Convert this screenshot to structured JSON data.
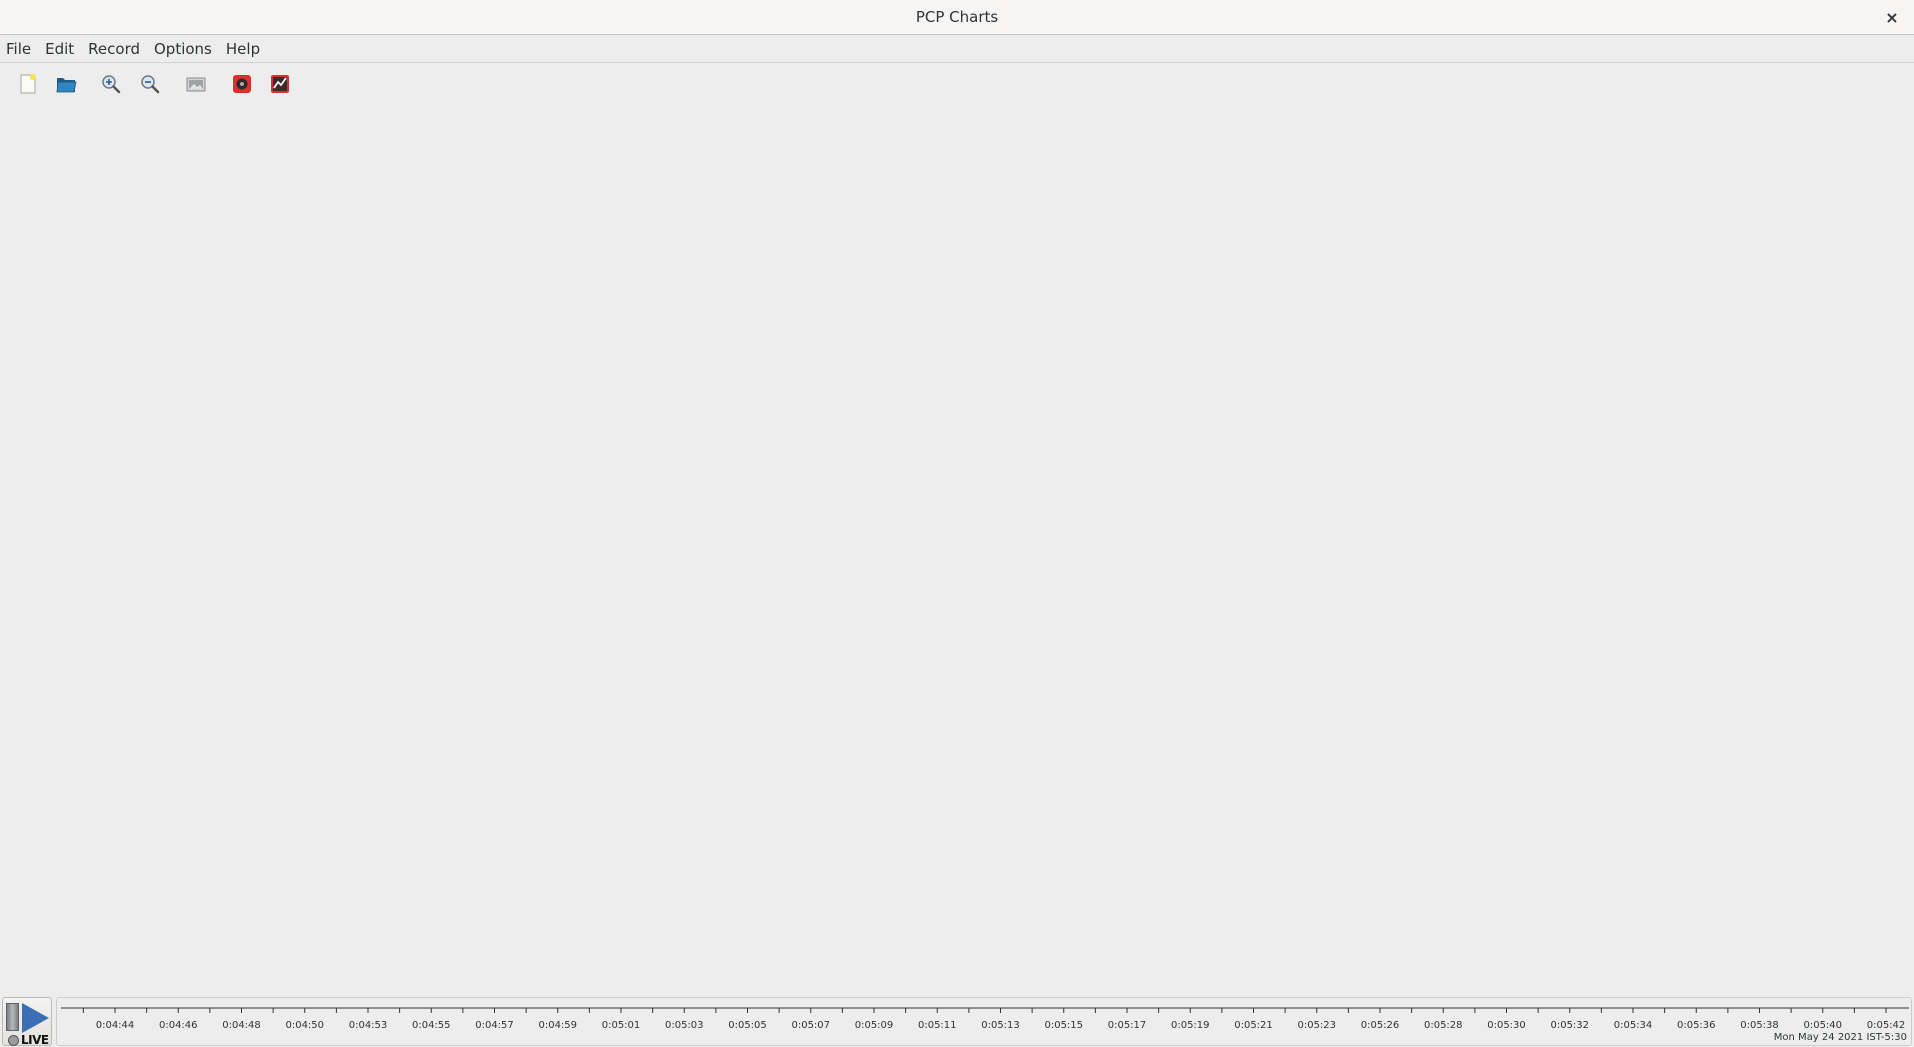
{
  "window": {
    "title": "PCP Charts",
    "close_glyph": "×"
  },
  "menu": [
    "File",
    "Edit",
    "Record",
    "Options",
    "Help"
  ],
  "toolbar": [
    {
      "name": "new-chart-button",
      "icon": "new-document-icon"
    },
    {
      "name": "open-view-button",
      "icon": "open-folder-icon"
    },
    {
      "name": "zoom-in-button",
      "icon": "zoom-in-icon"
    },
    {
      "name": "zoom-out-button",
      "icon": "zoom-out-icon"
    },
    {
      "name": "export-image-button",
      "icon": "image-icon"
    },
    {
      "name": "record-button",
      "icon": "record-icon"
    },
    {
      "name": "new-chart-button-2",
      "icon": "chart-icon"
    }
  ],
  "timecontrol": {
    "mode_label": "LIVE"
  },
  "timeaxis": {
    "labels": [
      "0:04:44",
      "0:04:46",
      "0:04:48",
      "0:04:50",
      "0:04:53",
      "0:04:55",
      "0:04:57",
      "0:04:59",
      "0:05:01",
      "0:05:03",
      "0:05:05",
      "0:05:07",
      "0:05:09",
      "0:05:11",
      "0:05:13",
      "0:05:15",
      "0:05:17",
      "0:05:19",
      "0:05:21",
      "0:05:23",
      "0:05:26",
      "0:05:28",
      "0:05:30",
      "0:05:32",
      "0:05:34",
      "0:05:36",
      "0:05:38",
      "0:05:40",
      "0:05:42"
    ],
    "datestamp": "Mon May 24 2021 IST-5:30"
  },
  "colors": {
    "accent": "#3b6fb5",
    "record": "#d9322e",
    "background": "#ededed"
  }
}
